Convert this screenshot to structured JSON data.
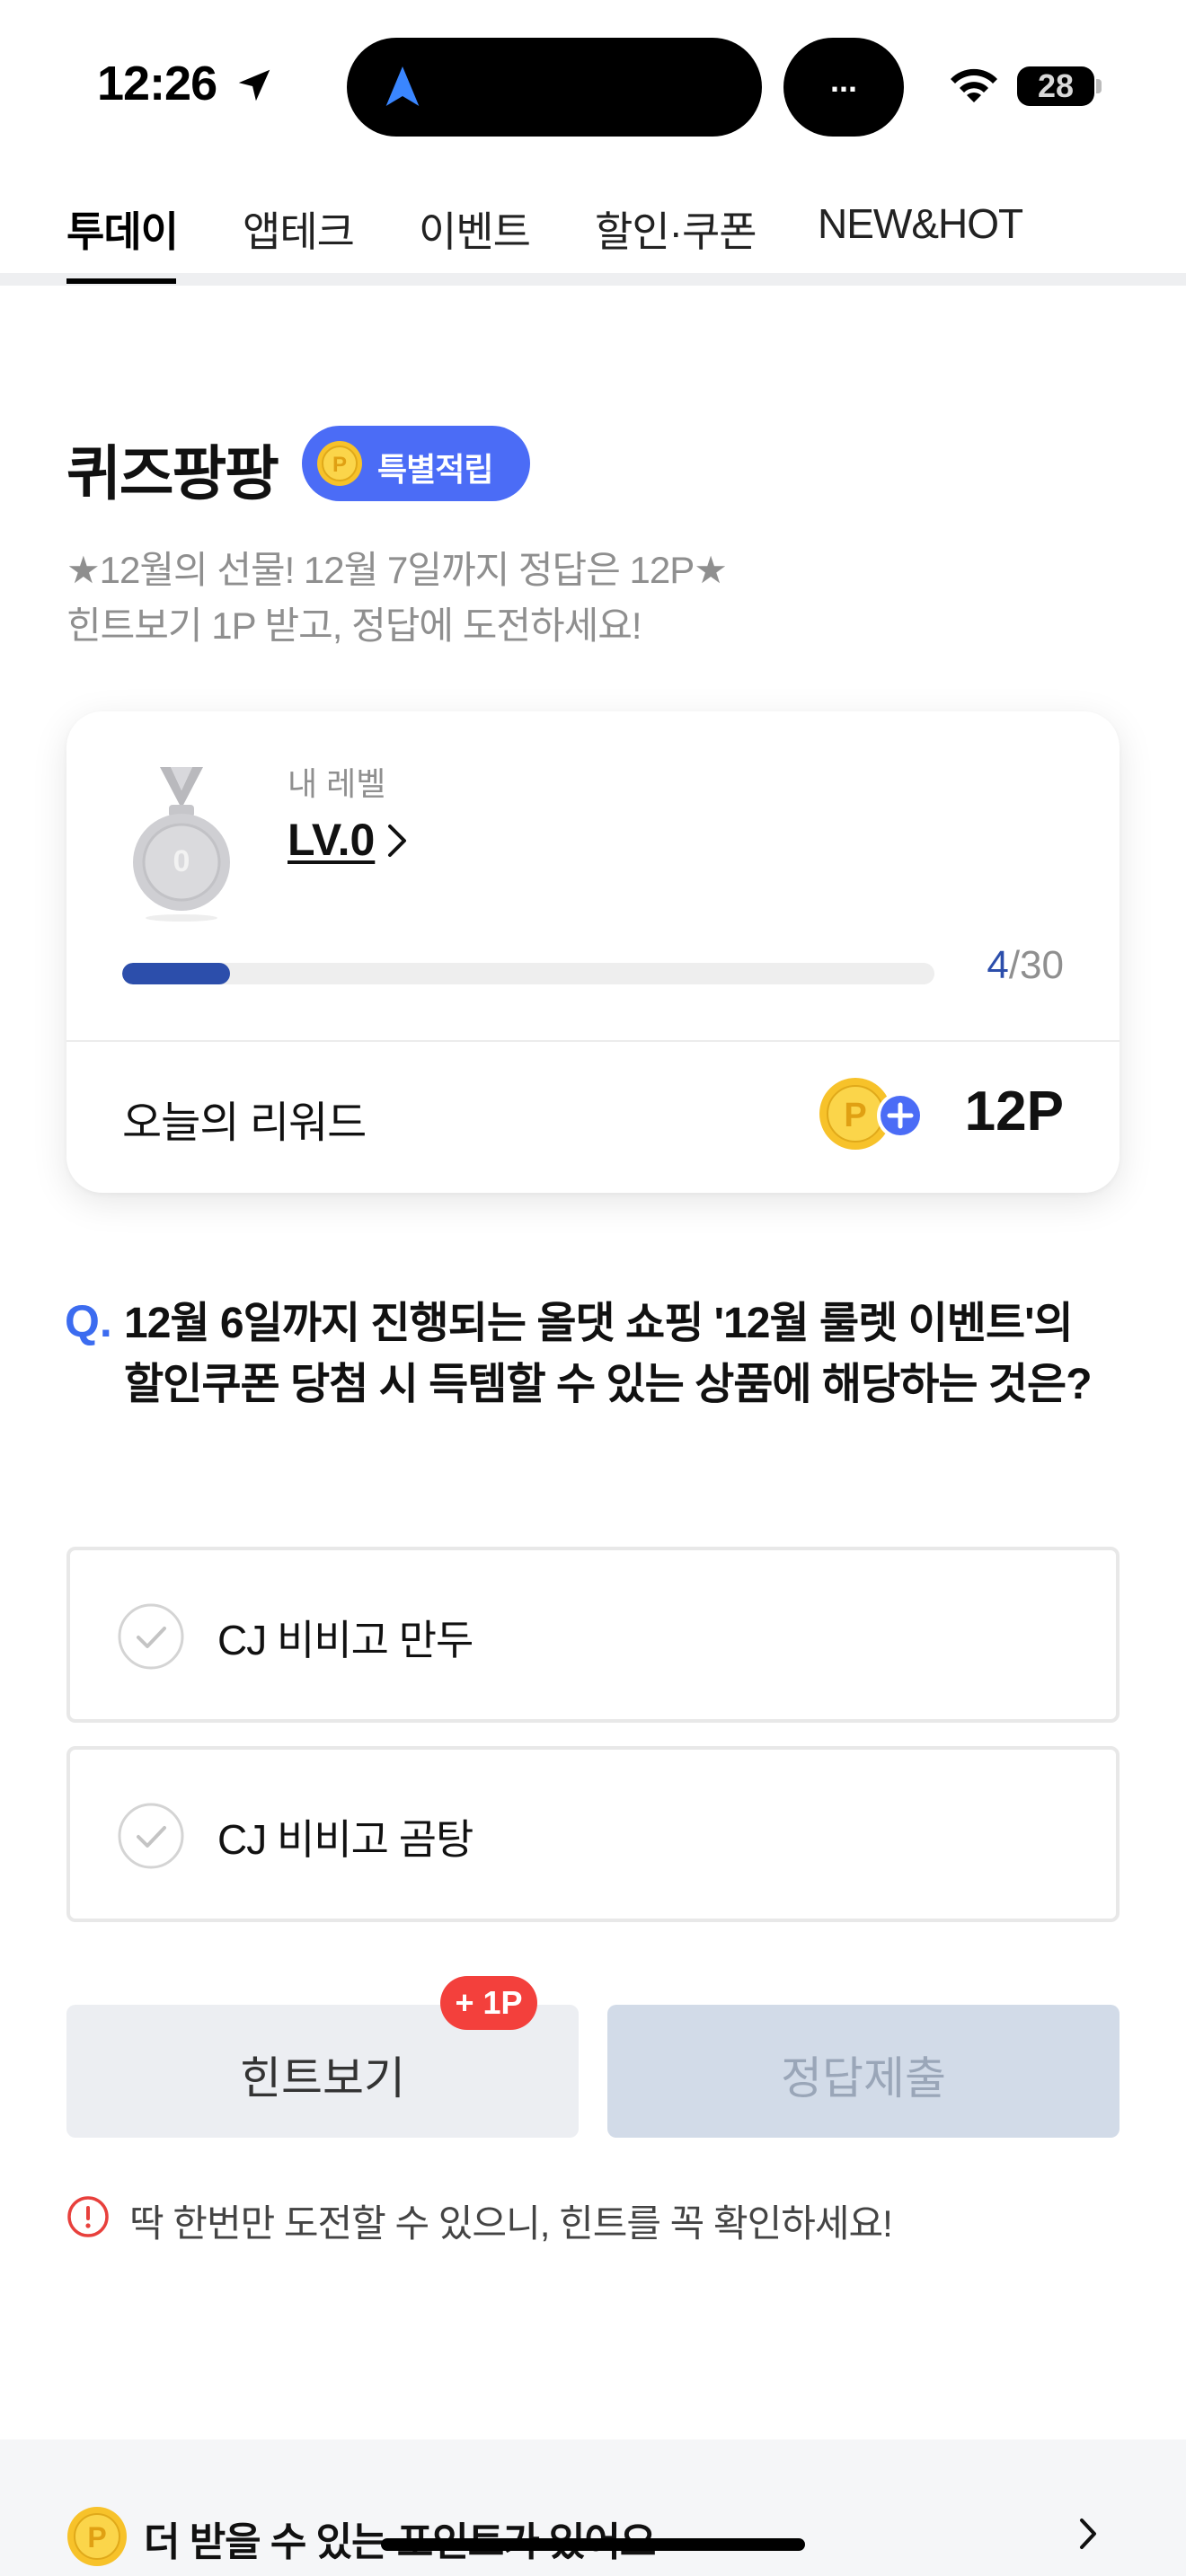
{
  "status_bar": {
    "time": "12:26",
    "island_dots": "...",
    "battery": "28"
  },
  "tabs": [
    {
      "label": "투데이",
      "active": true
    },
    {
      "label": "앱테크",
      "active": false
    },
    {
      "label": "이벤트",
      "active": false
    },
    {
      "label": "할인·쿠폰",
      "active": false
    },
    {
      "label": "NEW&HOT",
      "active": false
    }
  ],
  "quiz": {
    "title": "퀴즈팡팡",
    "badge": "특별적립",
    "subtitle_line1": "★12월의 선물! 12월 7일까지 정답은 12P★",
    "subtitle_line2": "힌트보기 1P 받고, 정답에 도전하세요!"
  },
  "level_card": {
    "label": "내 레벨",
    "level": "LV.0",
    "medal_number": "0",
    "progress_current": "4",
    "progress_total": "/30",
    "progress_fraction": 0.133,
    "reward_label": "오늘의 리워드",
    "reward_value": "12P"
  },
  "question": {
    "prefix": "Q.",
    "text": "12월 6일까지 진행되는 올댓 쇼핑 '12월 룰렛 이벤트'의 할인쿠폰 당첨 시 득템할 수 있는 상품에 해당하는 것은?",
    "options": [
      "CJ 비비고 만두",
      "CJ 비비고 곰탕"
    ]
  },
  "actions": {
    "hint_label": "힌트보기",
    "hint_badge": "+ 1P",
    "submit_label": "정답제출"
  },
  "warning": "딱 한번만 도전할 수 있으니, 힌트를 꼭 확인하세요!",
  "bottom_banner": {
    "text": "더 받을 수 있는 포인트가 있어요"
  },
  "colors": {
    "accent_blue": "#4b6cf6",
    "progress": "#2c4eab",
    "question_mark": "#3c6cf0",
    "badge_red": "#f3403c",
    "coin_gold": "#f7c22a"
  }
}
